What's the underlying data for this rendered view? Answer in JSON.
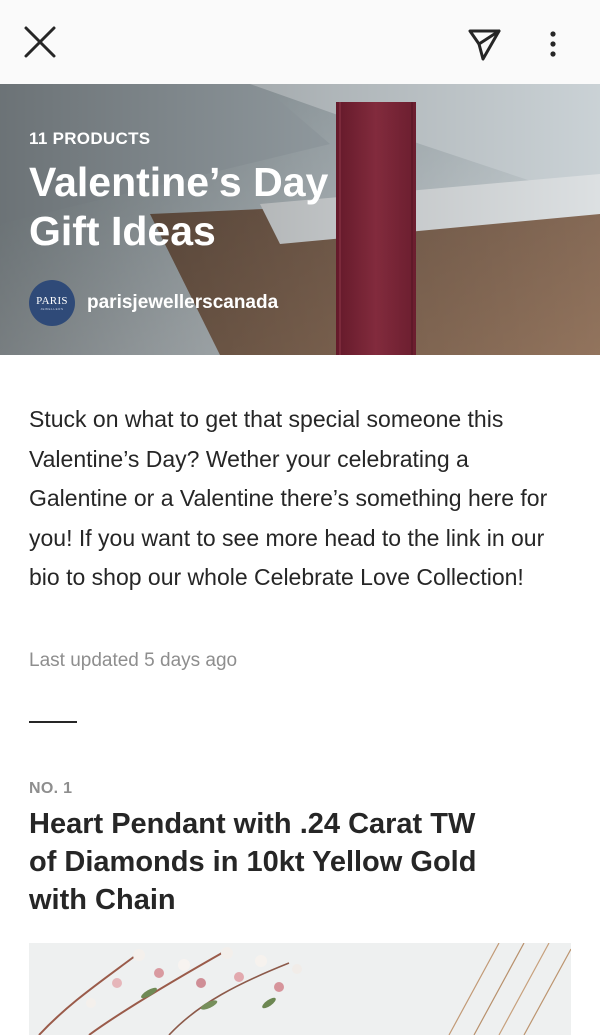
{
  "toolbar": {
    "close_icon": "close-icon",
    "share_icon": "paper-plane-icon",
    "more_icon": "more-vertical-icon"
  },
  "hero": {
    "count_label": "11 PRODUCTS",
    "title": "Valentine’s Day Gift Ideas",
    "avatar_text": "PARIS",
    "avatar_subtext": "JEWELLERS",
    "author": "parisjewellerscanada"
  },
  "guide": {
    "description": "Stuck on what to get that special someone this Valentine’s Day? Wether your celebrating a Galentine or a Valentine there’s something here for you! If you want to see more head to the link in our bio to shop our whole Celebrate Love Collection!",
    "last_updated": "Last updated 5 days ago"
  },
  "product": {
    "number_label": "NO. 1",
    "title": "Heart Pendant with .24 Carat TW of Diamonds in 10kt Yellow Gold with Chain"
  },
  "colors": {
    "text_primary": "#262626",
    "text_secondary": "#8e8e8e",
    "ribbon": "#8e2a3e",
    "topbar_bg": "#fafafa"
  }
}
